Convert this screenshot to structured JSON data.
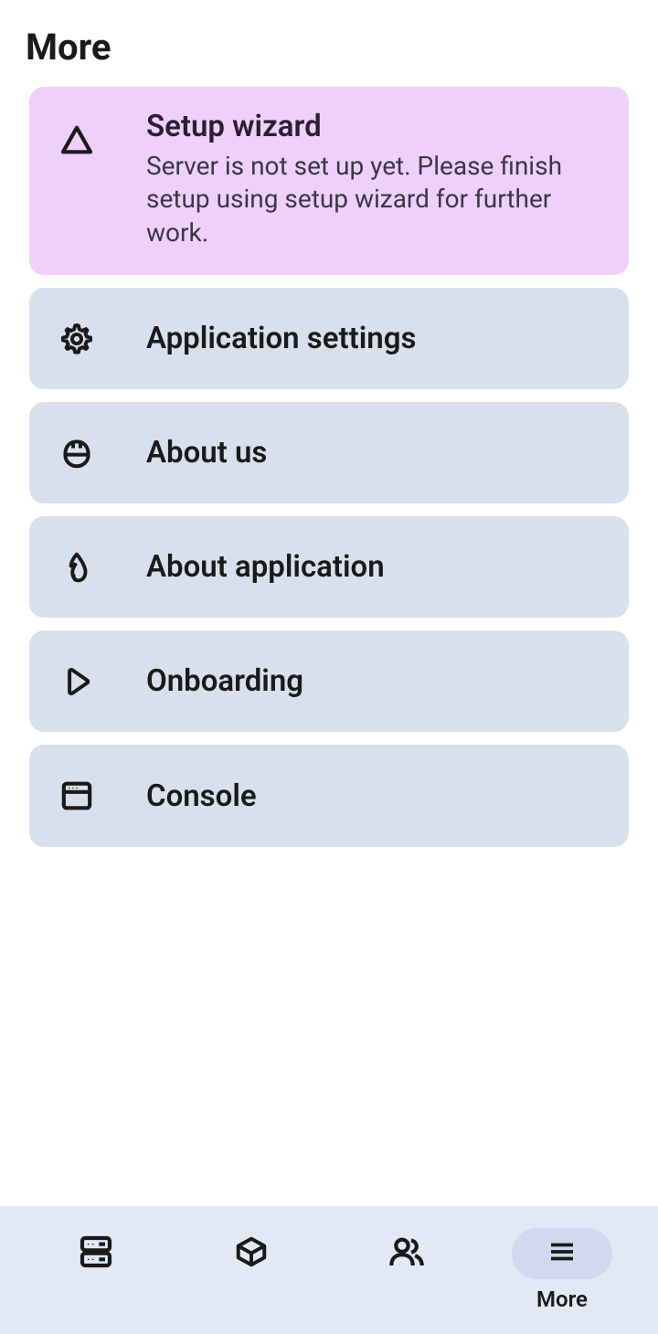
{
  "header": {
    "title": "More"
  },
  "cards": [
    {
      "title": "Setup wizard",
      "desc": "Server is not set up yet. Please finish setup using setup wizard for further work."
    },
    {
      "title": "Application settings"
    },
    {
      "title": "About us"
    },
    {
      "title": "About application"
    },
    {
      "title": "Onboarding"
    },
    {
      "title": "Console"
    }
  ],
  "nav": {
    "items": [
      {
        "label": ""
      },
      {
        "label": ""
      },
      {
        "label": ""
      },
      {
        "label": "More"
      }
    ]
  }
}
